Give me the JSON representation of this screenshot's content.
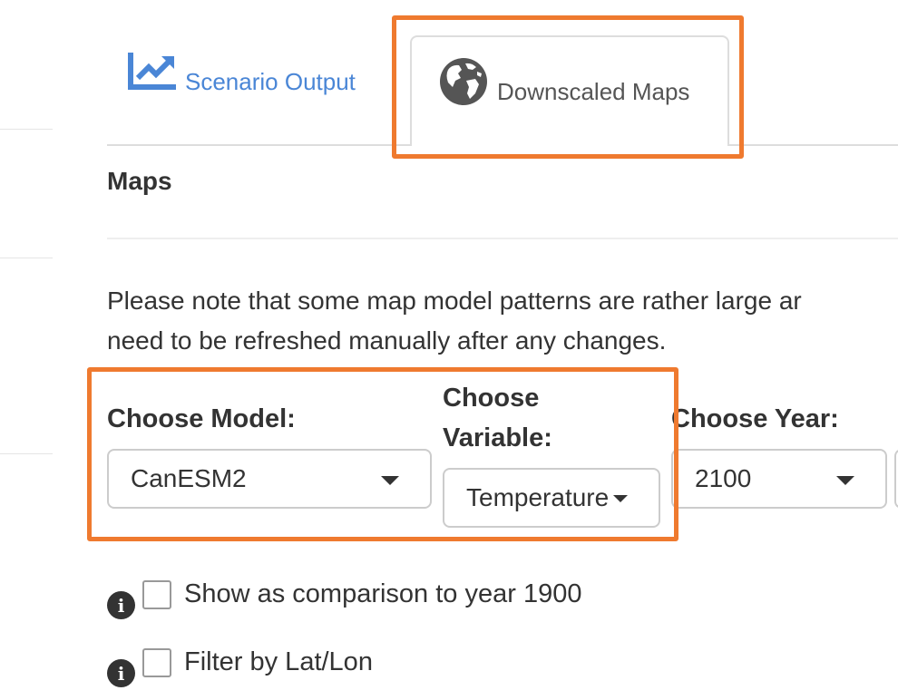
{
  "tabs": [
    {
      "label": "Scenario Output",
      "icon": "line-chart-icon",
      "active": false,
      "color": "#4a86d6"
    },
    {
      "label": "Downscaled Maps",
      "icon": "globe-icon",
      "active": true,
      "color": "#555555"
    }
  ],
  "section": {
    "title": "Maps",
    "note_line1": "Please note that some map model patterns are rather large ar",
    "note_line2": "need to be refreshed manually after any changes."
  },
  "controls": {
    "model": {
      "label": "Choose Model:",
      "value": "CanESM2"
    },
    "variable": {
      "label_line1": "Choose",
      "label_line2": "Variable:",
      "value": "Temperature"
    },
    "year": {
      "label": "Choose Year:",
      "value": "2100"
    }
  },
  "options": {
    "comparison": {
      "label": "Show as comparison to year 1900",
      "checked": false
    },
    "filter": {
      "label": "Filter by Lat/Lon",
      "checked": false
    }
  },
  "colors": {
    "highlight": "#ef7a2f",
    "link": "#4a86d6"
  }
}
